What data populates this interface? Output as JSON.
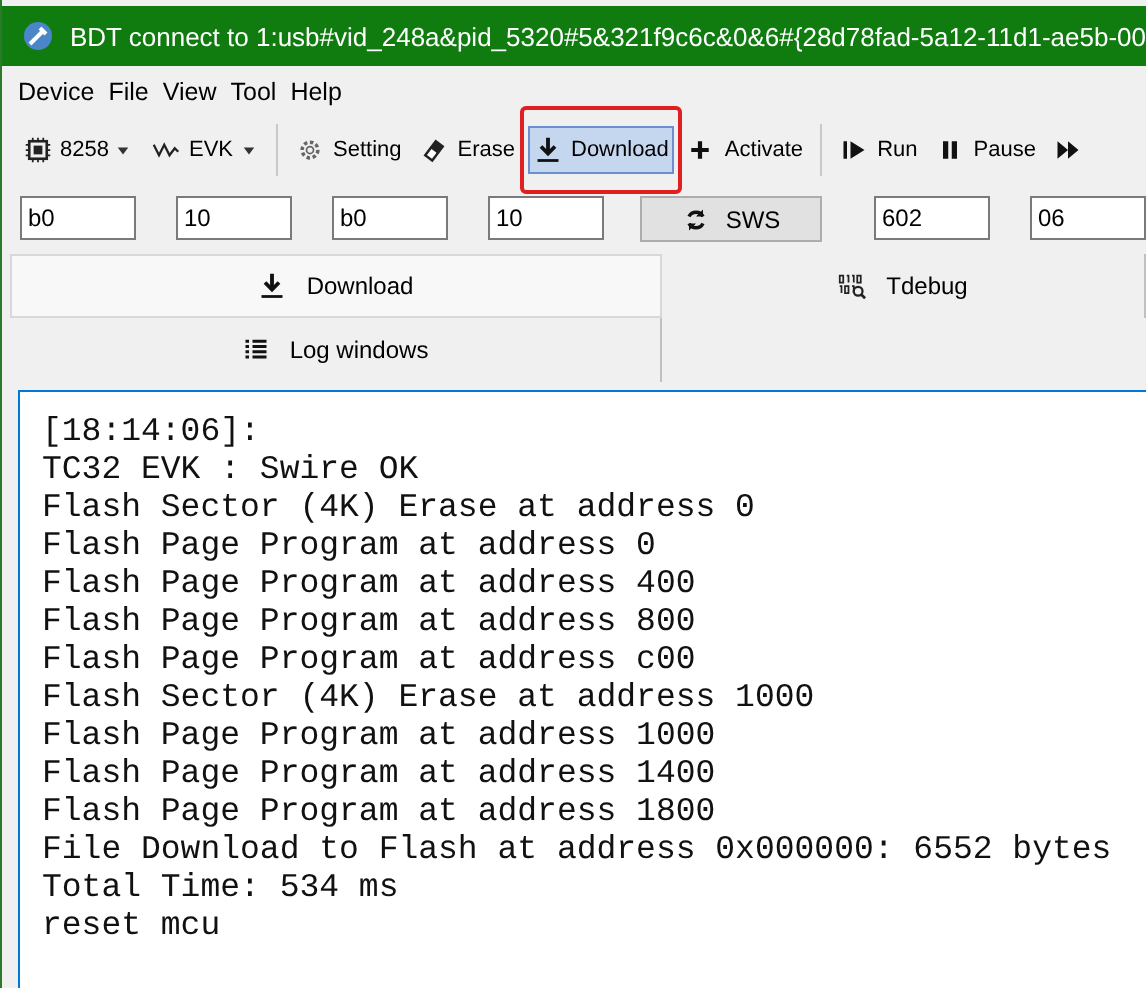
{
  "window": {
    "title": "BDT connect to 1:usb#vid_248a&pid_5320#5&321f9c6c&0&6#{28d78fad-5a12-11d1-ae5b-00"
  },
  "menu": [
    "Device",
    "File",
    "View",
    "Tool",
    "Help"
  ],
  "toolbar": [
    {
      "kind": "dropdown",
      "label": "8258"
    },
    {
      "kind": "dropdown",
      "label": "EVK"
    },
    {
      "kind": "separator"
    },
    {
      "kind": "button",
      "label": "Setting",
      "selected": false,
      "highlighted": false
    },
    {
      "kind": "button",
      "label": "Erase",
      "selected": false,
      "highlighted": false
    },
    {
      "kind": "button",
      "label": "Download",
      "selected": true,
      "highlighted": true
    },
    {
      "kind": "button",
      "label": "Activate",
      "selected": false,
      "highlighted": false
    },
    {
      "kind": "separator"
    },
    {
      "kind": "button",
      "label": "Run",
      "selected": false,
      "highlighted": false
    },
    {
      "kind": "button",
      "label": "Pause",
      "selected": false,
      "highlighted": false
    },
    {
      "kind": "button",
      "selected": false,
      "highlighted": false
    }
  ],
  "fields": [
    {
      "kind": "field",
      "value": "b0"
    },
    {
      "kind": "field",
      "value": "10"
    },
    {
      "kind": "field",
      "value": "b0"
    },
    {
      "kind": "field",
      "value": "10"
    },
    {
      "kind": "button",
      "label": "SWS"
    },
    {
      "kind": "field",
      "value": "602"
    },
    {
      "kind": "field",
      "value": "06"
    }
  ],
  "tabs": [
    {
      "label": "Download",
      "selected": true
    },
    {
      "label": "Tdebug",
      "selected": false
    },
    {
      "label": "Log windows",
      "selected": false
    }
  ],
  "log": [
    "[18:14:06]:",
    "TC32 EVK : Swire OK",
    "Flash Sector (4K) Erase at address 0",
    "Flash Page Program at address 0",
    "Flash Page Program at address 400",
    "Flash Page Program at address 800",
    "Flash Page Program at address c00",
    "Flash Sector (4K) Erase at address 1000",
    "Flash Page Program at address 1000",
    "Flash Page Program at address 1400",
    "Flash Page Program at address 1800",
    "File Download to Flash at address 0x000000: 6552 bytes",
    "Total Time: 534 ms",
    "reset mcu"
  ]
}
